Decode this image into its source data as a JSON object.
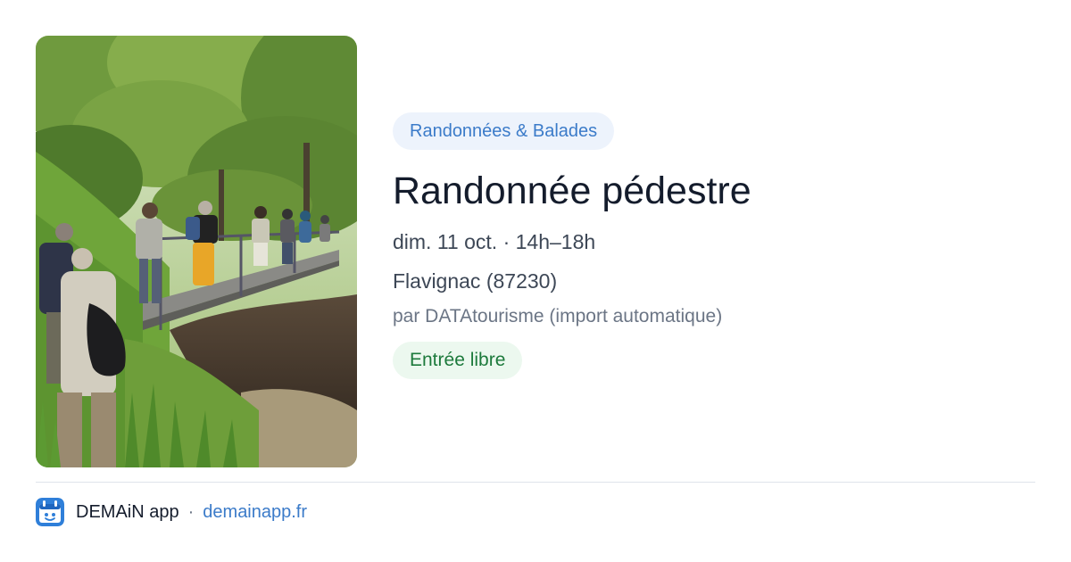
{
  "event": {
    "category": "Randonnées & Balades",
    "title": "Randonnée pédestre",
    "datetime": "dim. 11 oct. · 14h–18h",
    "location": "Flavignac (87230)",
    "organizer": "par DATAtourisme (import automatique)",
    "price": "Entrée libre"
  },
  "footer": {
    "app_name": "DEMAiN app",
    "separator": "·",
    "link_text": "demainapp.fr"
  },
  "icons": {
    "app_logo": "demain-app-logo-icon"
  },
  "colors": {
    "accent": "#3b7bc9",
    "title_text": "#141c2c",
    "category_badge_bg": "#edf3fc",
    "price_badge_bg": "#ecf8ef",
    "price_badge_text": "#1d7a3c"
  }
}
